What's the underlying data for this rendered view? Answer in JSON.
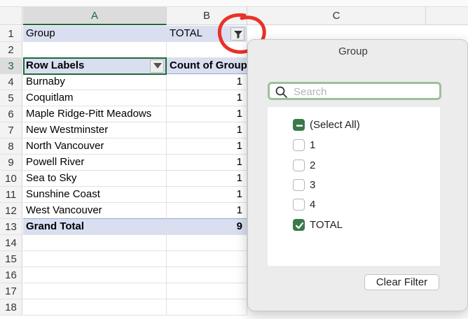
{
  "columns": [
    "A",
    "B",
    "C"
  ],
  "rows": [
    "1",
    "2",
    "3",
    "4",
    "5",
    "6",
    "7",
    "8",
    "9",
    "10",
    "11",
    "12",
    "13",
    "14",
    "15",
    "16",
    "17",
    "18"
  ],
  "filter_row": {
    "field": "Group",
    "value": "TOTAL"
  },
  "pivot": {
    "row_labels_header": "Row Labels",
    "count_header": "Count of Group",
    "items": [
      {
        "label": "Burnaby",
        "count": "1"
      },
      {
        "label": "Coquitlam",
        "count": "1"
      },
      {
        "label": "Maple Ridge-Pitt Meadows",
        "count": "1"
      },
      {
        "label": "New Westminster",
        "count": "1"
      },
      {
        "label": "North Vancouver",
        "count": "1"
      },
      {
        "label": "Powell River",
        "count": "1"
      },
      {
        "label": "Sea to Sky",
        "count": "1"
      },
      {
        "label": "Sunshine Coast",
        "count": "1"
      },
      {
        "label": "West Vancouver",
        "count": "1"
      }
    ],
    "grand_total_label": "Grand Total",
    "grand_total_value": "9"
  },
  "filter_popover": {
    "title": "Group",
    "search_placeholder": "Search",
    "options": [
      {
        "label": "(Select All)",
        "state": "mixed"
      },
      {
        "label": "1",
        "state": "unchecked"
      },
      {
        "label": "2",
        "state": "unchecked"
      },
      {
        "label": "3",
        "state": "unchecked"
      },
      {
        "label": "4",
        "state": "unchecked"
      },
      {
        "label": "TOTAL",
        "state": "checked"
      }
    ],
    "clear_filter_label": "Clear Filter"
  },
  "colors": {
    "accent_green": "#1d6b3a",
    "pivot_band": "#d9dff0",
    "annotation_red": "#e8322a",
    "checkbox_green": "#3b7a4a"
  }
}
